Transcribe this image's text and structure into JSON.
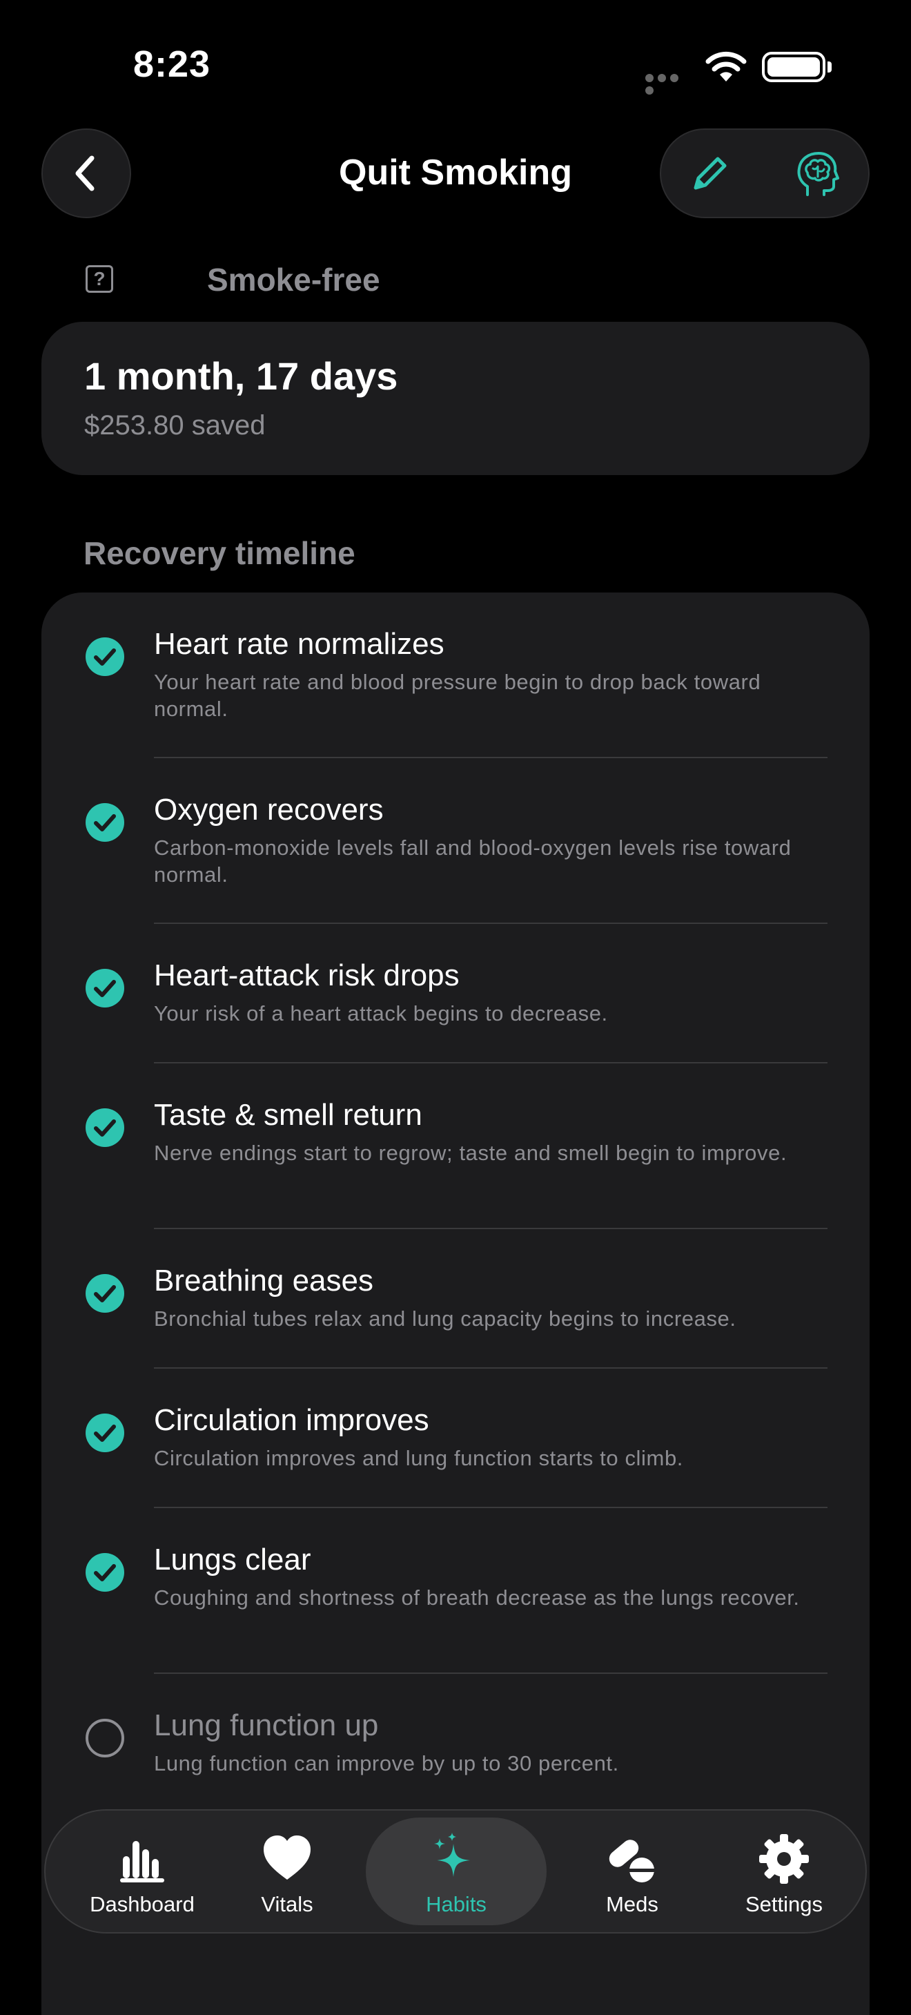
{
  "status_bar": {
    "time": "8:23"
  },
  "header": {
    "title": "Quit Smoking",
    "back_icon": "chevron-left-icon",
    "edit_icon": "pencil-icon",
    "insight_icon": "brain-head-icon"
  },
  "smoke_free": {
    "label": "Smoke-free",
    "duration": "1 month, 17 days",
    "saved": "$253.80 saved"
  },
  "timeline": {
    "title": "Recovery timeline",
    "items": [
      {
        "title": "Heart rate normalizes",
        "desc": "Your heart rate and blood pressure begin to drop back toward normal.",
        "done": true
      },
      {
        "title": "Oxygen recovers",
        "desc": "Carbon-monoxide levels fall and blood-oxygen levels rise toward normal.",
        "done": true
      },
      {
        "title": "Heart-attack risk drops",
        "desc": "Your risk of a heart attack begins to decrease.",
        "done": true
      },
      {
        "title": "Taste & smell return",
        "desc": "Nerve endings start to regrow; taste and smell begin to improve.",
        "done": true
      },
      {
        "title": "Breathing eases",
        "desc": "Bronchial tubes relax and lung capacity begins to increase.",
        "done": true
      },
      {
        "title": "Circulation improves",
        "desc": "Circulation improves and lung function starts to climb.",
        "done": true
      },
      {
        "title": "Lungs clear",
        "desc": "Coughing and shortness of breath decrease as the lungs recover.",
        "done": true
      },
      {
        "title": "Lung function up",
        "desc": "Lung function can improve by up to 30 percent.",
        "done": false
      }
    ]
  },
  "tabbar": {
    "tabs": [
      {
        "label": "Dashboard",
        "icon": "bar-chart-icon",
        "active": false
      },
      {
        "label": "Vitals",
        "icon": "heart-icon",
        "active": false
      },
      {
        "label": "Habits",
        "icon": "sparkles-icon",
        "active": true
      },
      {
        "label": "Meds",
        "icon": "pills-icon",
        "active": false
      },
      {
        "label": "Settings",
        "icon": "gear-icon",
        "active": false
      }
    ]
  },
  "colors": {
    "accent": "#2ec4b0",
    "background": "#000000",
    "card": "#1c1c1e",
    "secondary_text": "#8e8e93"
  }
}
